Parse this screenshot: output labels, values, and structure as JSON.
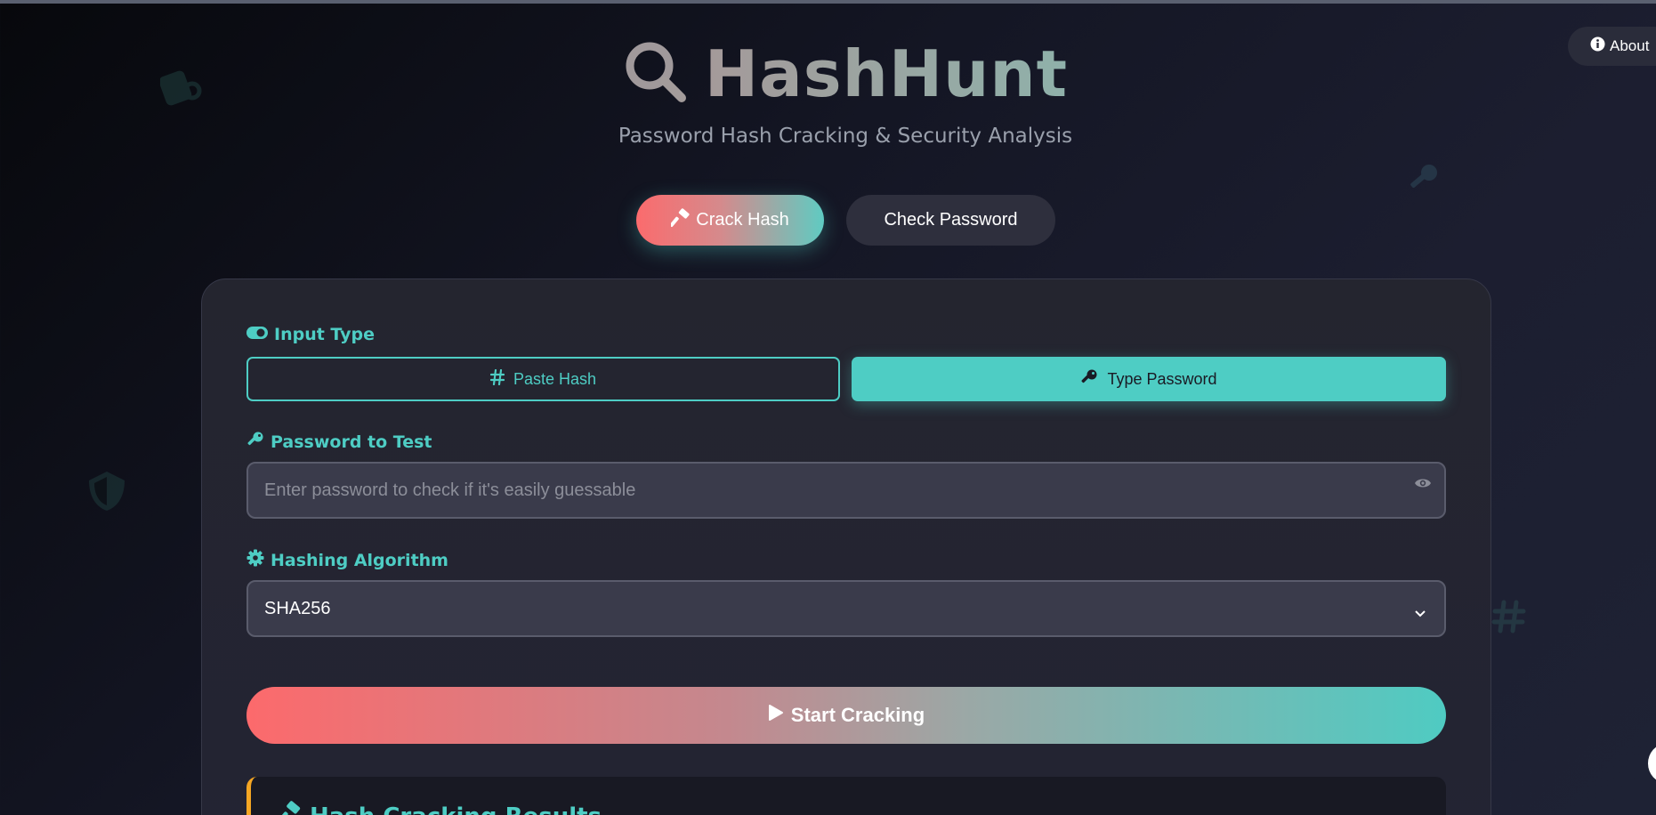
{
  "header": {
    "title": "HashHunt",
    "subtitle": "Password Hash Cracking & Security Analysis",
    "logo_icon": "search-icon"
  },
  "about_button": {
    "label": "About",
    "icon": "info-circle-icon"
  },
  "mode_tabs": [
    {
      "label": "Crack Hash",
      "icon": "hammer-icon",
      "active": true
    },
    {
      "label": "Check Password",
      "active": false
    }
  ],
  "input_type": {
    "label": "Input Type",
    "icon": "toggle-icon",
    "options": [
      {
        "label": "Paste Hash",
        "icon": "hashtag-icon",
        "active": false
      },
      {
        "label": "Type Password",
        "icon": "key-icon",
        "active": true
      }
    ]
  },
  "password_field": {
    "label": "Password to Test",
    "icon": "key-icon",
    "placeholder": "Enter password to check if it's easily guessable",
    "value": ""
  },
  "algorithm_field": {
    "label": "Hashing Algorithm",
    "icon": "gear-icon",
    "selected": "SHA256"
  },
  "start_button": {
    "label": "Start Cracking",
    "icon": "play-icon"
  },
  "results": {
    "title": "Hash Cracking Results",
    "icon": "hammer-icon"
  },
  "colors": {
    "accent_teal": "#4ecdc4",
    "accent_coral": "#ff6b6b",
    "results_border": "#f5a623"
  }
}
